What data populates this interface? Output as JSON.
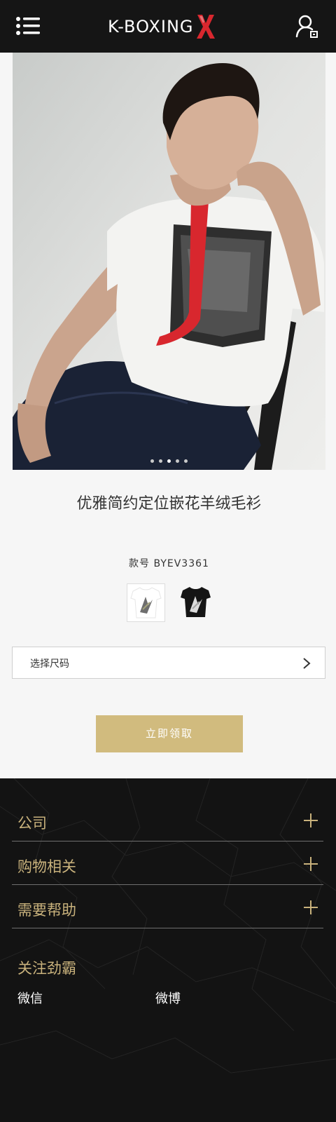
{
  "header": {
    "brand_text": "K-BOXING",
    "menu_icon": "menu-icon",
    "user_icon": "user-icon",
    "brand_color": "#d8272e"
  },
  "product": {
    "image_icon": "model-wearing-tshirt",
    "carousel": {
      "total": 5,
      "active": 3
    },
    "title": "优雅简约定位嵌花羊绒毛衫",
    "style_number": "款号 BYEV3361",
    "swatches": [
      "white",
      "black"
    ],
    "size_select_label": "选择尺码",
    "claim_button": "立即领取",
    "accent_color": "#d1bb7e"
  },
  "footer": {
    "sections": [
      {
        "label": "公司"
      },
      {
        "label": "购物相关"
      },
      {
        "label": "需要帮助"
      }
    ],
    "follow_title": "关注劲霸",
    "social": [
      "微信",
      "微博"
    ],
    "gold_color": "#c9b27c"
  }
}
